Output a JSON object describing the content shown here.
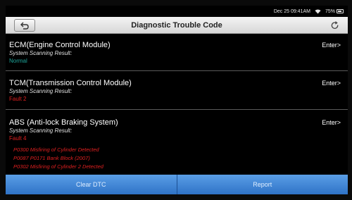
{
  "status_bar": {
    "time": "Dec 25 09:41AM",
    "battery": "75%"
  },
  "header": {
    "title": "Diagnostic Trouble Code"
  },
  "icons": {
    "back": "back-arrow-icon",
    "refresh": "refresh-icon",
    "wifi": "wifi-icon",
    "battery": "battery-icon"
  },
  "modules": [
    {
      "name": "ECM(Engine Control Module)",
      "subtitle": "System Scanning Result:",
      "status": "Normal",
      "status_type": "ok",
      "enter": "Enter>",
      "codes": []
    },
    {
      "name": "TCM(Transmission Control Module)",
      "subtitle": "System Scanning Result:",
      "status": "Fault 2",
      "status_type": "bad",
      "enter": "Enter>",
      "codes": []
    },
    {
      "name": "ABS (Anti-lock Braking System)",
      "subtitle": "System Scanning Result:",
      "status": "Fault 4",
      "status_type": "bad",
      "enter": "Enter>",
      "codes": [
        "P0300 Misfiring of Cylinder Detected",
        "P0087 P0171 Bank Block (2007)",
        "P0302 Misfiring of Cylinder 2 Detected"
      ]
    }
  ],
  "footer": {
    "clear_label": "Clear DTC",
    "report_label": "Report"
  },
  "colors": {
    "ok": "#1ea59a",
    "fault": "#e02020",
    "footer": "#3b82d6"
  }
}
